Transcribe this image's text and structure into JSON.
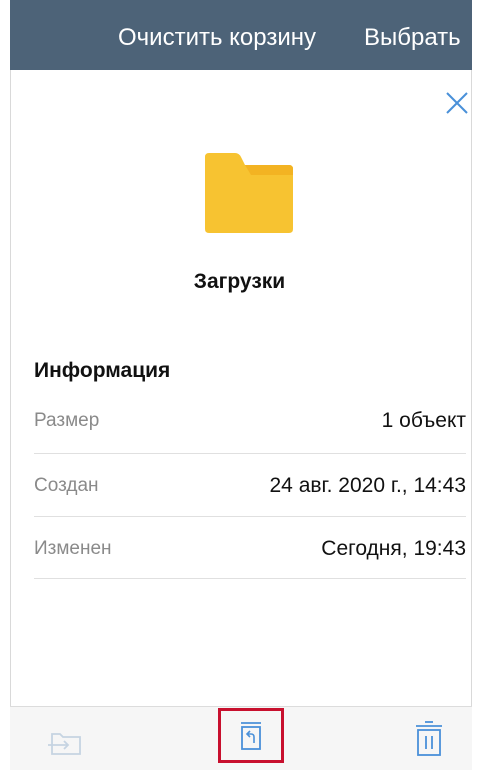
{
  "topbar": {
    "clear_label": "Очистить корзину",
    "select_label": "Выбрать",
    "background": "#4d6378"
  },
  "close": {
    "icon": "close-icon",
    "color": "#4a90d9"
  },
  "folder": {
    "icon": "folder-icon",
    "name": "Загрузки",
    "color": "#f7c331"
  },
  "info": {
    "title": "Информация",
    "rows": [
      {
        "label": "Размер",
        "value": "1 объект"
      },
      {
        "label": "Создан",
        "value": "24 авг. 2020 г., 14:43"
      },
      {
        "label": "Изменен",
        "value": "Сегодня, 19:43"
      }
    ]
  },
  "toolbar": {
    "move_icon": "move-to-folder-icon",
    "restore_icon": "restore-icon",
    "delete_icon": "trash-icon",
    "icon_color": "#4a90d9",
    "disabled_color": "#c6d4e2",
    "highlight_color": "#c8102e"
  }
}
